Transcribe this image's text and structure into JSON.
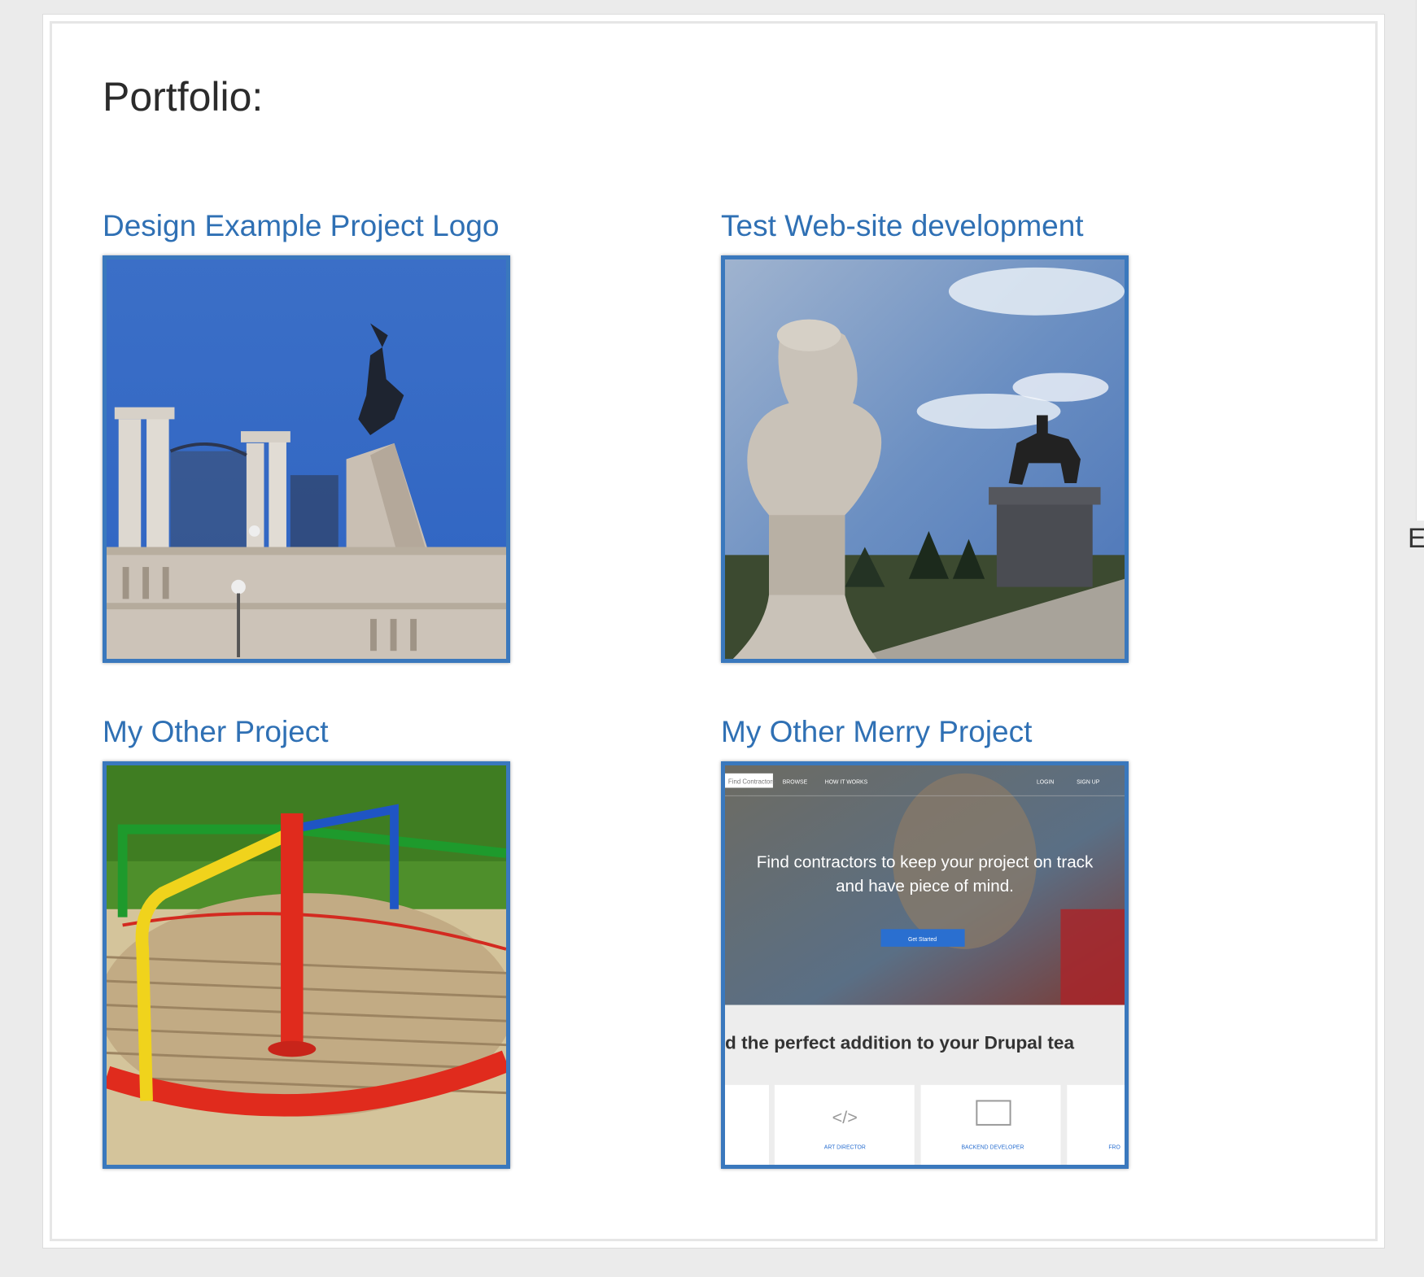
{
  "section": {
    "title": "Portfolio:"
  },
  "projects": [
    {
      "title": "Design Example Project Logo",
      "image": "monument-eagle-gate-photo"
    },
    {
      "title": "Test Web-site development",
      "image": "statue-equestrian-photo"
    },
    {
      "title": "My Other Project",
      "image": "playground-merry-go-round-photo"
    },
    {
      "title": "My Other Merry Project",
      "image": "website-screenshot"
    }
  ],
  "website_screenshot": {
    "nav_search": "Find Contractors",
    "nav_browse": "BROWSE",
    "nav_how": "HOW IT WORKS",
    "nav_login": "LOGIN",
    "nav_signup": "SIGN UP",
    "hero_line1": "Find contractors to keep your project on track",
    "hero_line2": "and have piece of mind.",
    "cta": "Get Started",
    "tagline": "d the perfect addition to your Drupal tea",
    "card1_label": "ART DIRECTOR",
    "card2_label": "BACKEND DEVELOPER",
    "card3_label": "FRO"
  },
  "edge": {
    "letter": "E"
  },
  "colors": {
    "link": "#2f70b4",
    "thumb_border": "#3a78bd",
    "page_bg": "#ebebeb"
  }
}
